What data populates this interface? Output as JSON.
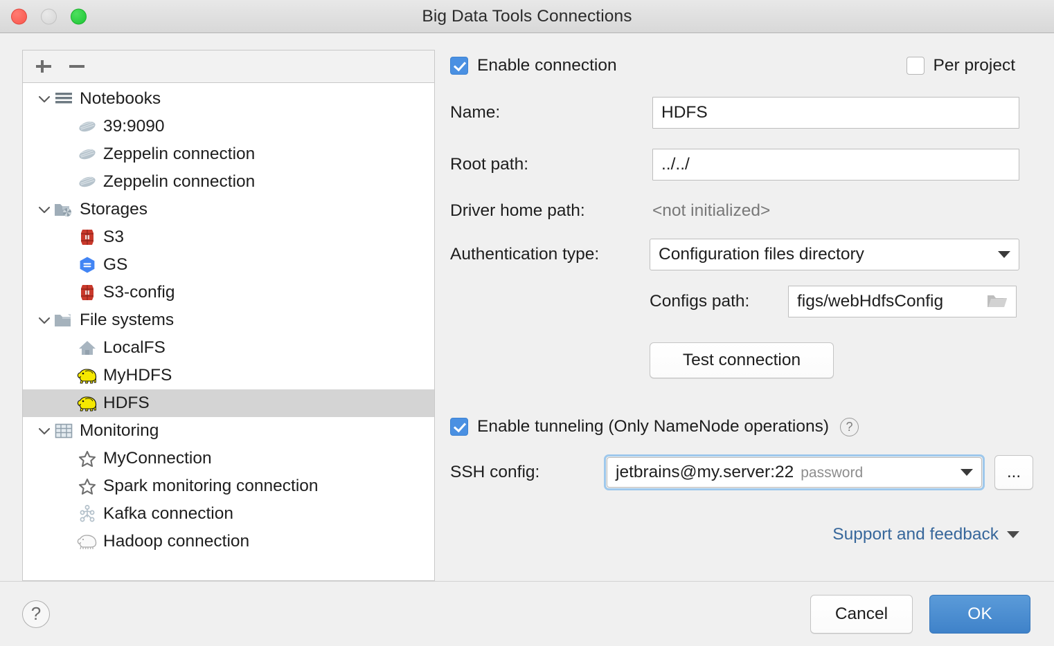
{
  "window": {
    "title": "Big Data Tools Connections",
    "traffic_lights": [
      "close",
      "minimize",
      "zoom"
    ]
  },
  "tree_toolbar": {
    "add_label": "+",
    "remove_label": "−"
  },
  "tree": {
    "items": [
      {
        "label": "Notebooks",
        "icon": "notebooks-icon",
        "level": 0,
        "expanded": true,
        "selected": false
      },
      {
        "label": "39:9090",
        "icon": "zeppelin-icon",
        "level": 1,
        "expanded": null,
        "selected": false
      },
      {
        "label": "Zeppelin connection",
        "icon": "zeppelin-icon",
        "level": 1,
        "expanded": null,
        "selected": false
      },
      {
        "label": "Zeppelin connection",
        "icon": "zeppelin-icon",
        "level": 1,
        "expanded": null,
        "selected": false
      },
      {
        "label": "Storages",
        "icon": "storages-folder-icon",
        "level": 0,
        "expanded": true,
        "selected": false
      },
      {
        "label": "S3",
        "icon": "s3-bucket-icon",
        "level": 1,
        "expanded": null,
        "selected": false
      },
      {
        "label": "GS",
        "icon": "google-storage-icon",
        "level": 1,
        "expanded": null,
        "selected": false
      },
      {
        "label": "S3-config",
        "icon": "s3-bucket-icon",
        "level": 1,
        "expanded": null,
        "selected": false
      },
      {
        "label": "File systems",
        "icon": "folder-icon",
        "level": 0,
        "expanded": true,
        "selected": false
      },
      {
        "label": "LocalFS",
        "icon": "home-icon",
        "level": 1,
        "expanded": null,
        "selected": false
      },
      {
        "label": "MyHDFS",
        "icon": "hadoop-elephant-icon",
        "level": 1,
        "expanded": null,
        "selected": false
      },
      {
        "label": "HDFS",
        "icon": "hadoop-elephant-icon",
        "level": 1,
        "expanded": null,
        "selected": true
      },
      {
        "label": "Monitoring",
        "icon": "monitoring-table-icon",
        "level": 0,
        "expanded": true,
        "selected": false
      },
      {
        "label": "MyConnection",
        "icon": "star-icon",
        "level": 1,
        "expanded": null,
        "selected": false
      },
      {
        "label": "Spark monitoring connection",
        "icon": "star-icon",
        "level": 1,
        "expanded": null,
        "selected": false
      },
      {
        "label": "Kafka connection",
        "icon": "kafka-icon",
        "level": 1,
        "expanded": null,
        "selected": false
      },
      {
        "label": "Hadoop connection",
        "icon": "hadoop-outline-icon",
        "level": 1,
        "expanded": null,
        "selected": false
      }
    ]
  },
  "form": {
    "enable_connection": {
      "label": "Enable connection",
      "checked": true
    },
    "per_project": {
      "label": "Per project",
      "checked": false
    },
    "name": {
      "label": "Name:",
      "value": "HDFS"
    },
    "root_path": {
      "label": "Root path:",
      "value": "../../"
    },
    "driver_home_path": {
      "label": "Driver home path:",
      "value": "<not initialized>"
    },
    "auth_type": {
      "label": "Authentication type:",
      "value": "Configuration files directory"
    },
    "configs_path": {
      "label": "Configs path:",
      "value": "figs/webHdfsConfig",
      "browse_icon": "folder-open-icon"
    },
    "test_connection": {
      "label": "Test connection"
    },
    "enable_tunneling": {
      "label": "Enable tunneling (Only NameNode operations)",
      "checked": true,
      "help_icon": "question-mark-icon"
    },
    "ssh_config": {
      "label": "SSH config:",
      "value": "jetbrains@my.server:22",
      "hint": "password",
      "browse_label": "..."
    },
    "support_link": {
      "label": "Support and feedback"
    }
  },
  "footer": {
    "help_label": "?",
    "cancel_label": "Cancel",
    "ok_label": "OK"
  },
  "colors": {
    "accent": "#4a90e2",
    "ok_button": "#4585cc",
    "link": "#37679b",
    "focus_ring": "#9ec8ec",
    "selection": "#d4d4d4"
  }
}
